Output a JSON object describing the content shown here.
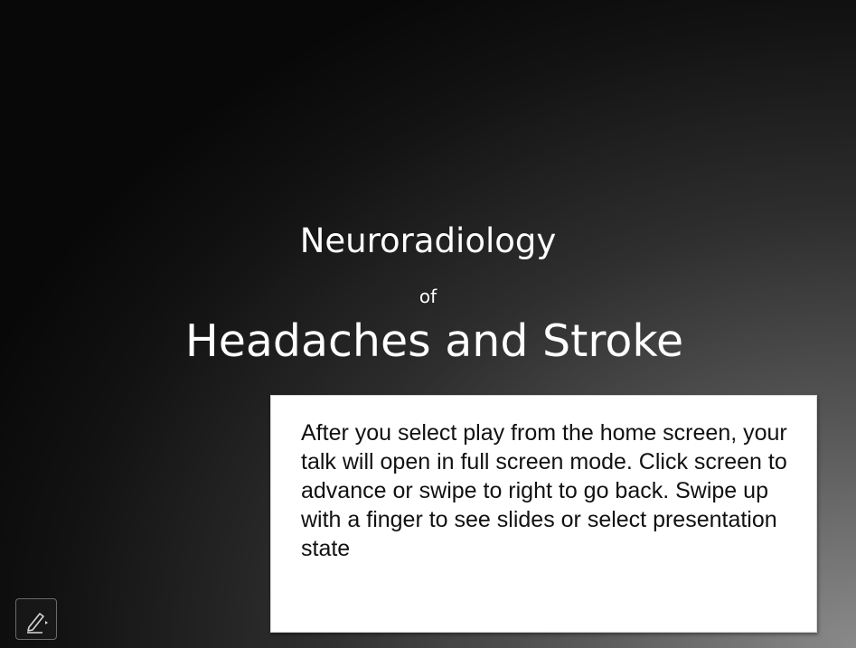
{
  "slide": {
    "title_line_1": "Neuroradiology",
    "title_line_2": "of",
    "title_line_3": "Headaches and Stroke"
  },
  "tip": {
    "text": "After you select play from the home screen, your talk will open in full screen mode.  Click screen to advance or swipe to right to go back.  Swipe up with a finger to see slides or select presentation state"
  },
  "controls": {
    "pen_icon": "pen-icon"
  },
  "colors": {
    "slide_background_dark": "#080808",
    "slide_background_light": "#8a8a8a",
    "title_text": "#ffffff",
    "tip_background": "#ffffff",
    "tip_text": "#111111"
  }
}
